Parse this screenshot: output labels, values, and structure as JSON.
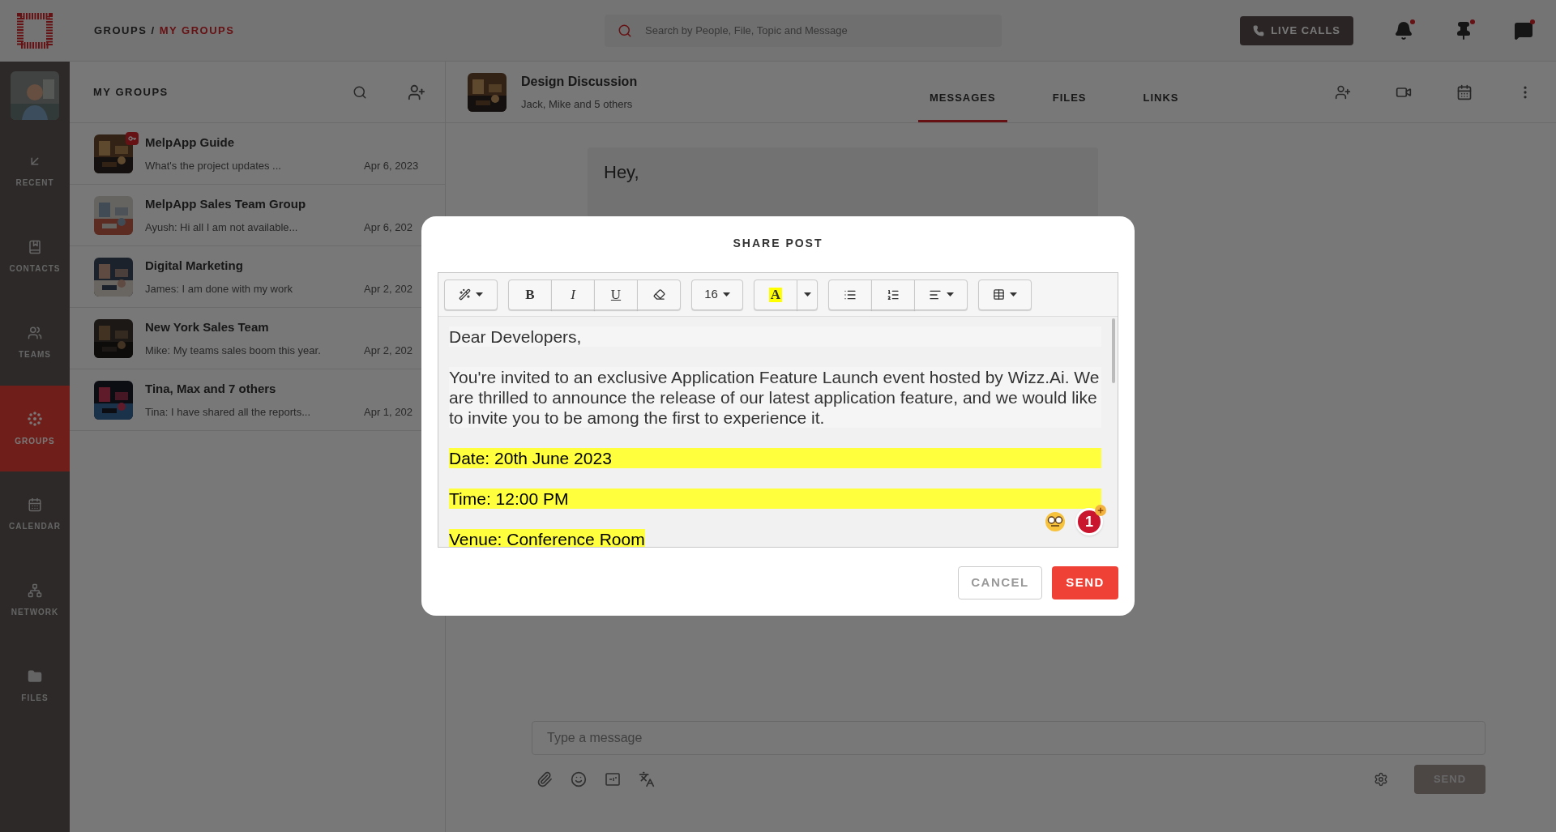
{
  "breadcrumb": {
    "parent": "GROUPS",
    "separator": "/",
    "current": "MY GROUPS"
  },
  "search": {
    "placeholder": "Search by People, File, Topic and Message"
  },
  "live_calls": "LIVE CALLS",
  "top_icons": [
    {
      "kind": "bell",
      "badge": true
    },
    {
      "kind": "pin",
      "badge": true
    },
    {
      "kind": "chat",
      "badge": true
    }
  ],
  "nav": [
    {
      "kind": "recent",
      "label": "RECENT",
      "selected": false
    },
    {
      "kind": "contacts",
      "label": "CONTACTS",
      "selected": false
    },
    {
      "kind": "teams",
      "label": "TEAMS",
      "selected": false
    },
    {
      "kind": "groups",
      "label": "GROUPS",
      "selected": true
    },
    {
      "kind": "calendar",
      "label": "CALENDAR",
      "selected": false
    },
    {
      "kind": "network",
      "label": "NETWORK",
      "selected": false
    },
    {
      "kind": "files",
      "label": "FILES",
      "selected": false
    }
  ],
  "groups_panel": {
    "title": "MY GROUPS",
    "items": [
      {
        "name": "MelpApp Guide",
        "preview": "What's the project updates ...",
        "date": "Apr 6, 2023",
        "locked": true
      },
      {
        "name": "MelpApp Sales Team Group",
        "preview": "Ayush: Hi all I am not available...",
        "date": "Apr 6, 202",
        "locked": false
      },
      {
        "name": "Digital Marketing",
        "preview": "James: I am done with my work",
        "date": "Apr 2, 202",
        "locked": false
      },
      {
        "name": "New York Sales Team",
        "preview": "Mike: My teams sales boom this year.",
        "date": "Apr 2, 202",
        "locked": false
      },
      {
        "name": "Tina, Max and 7 others",
        "preview": "Tina: I have shared all the reports...",
        "date": "Apr 1, 202",
        "locked": false
      }
    ]
  },
  "chat": {
    "title": "Design Discussion",
    "members": "Jack, Mike and 5 others",
    "tabs": [
      {
        "label": "MESSAGES",
        "selected": true
      },
      {
        "label": "FILES",
        "selected": false
      },
      {
        "label": "LINKS",
        "selected": false
      }
    ],
    "actions": [
      {
        "kind": "add_member"
      },
      {
        "kind": "video"
      },
      {
        "kind": "calendar"
      },
      {
        "kind": "more"
      }
    ],
    "messages": [
      "Hey,"
    ],
    "composer": {
      "placeholder": "Type a message",
      "tools": [
        {
          "kind": "attach"
        },
        {
          "kind": "emoji"
        },
        {
          "kind": "gif"
        },
        {
          "kind": "translate"
        }
      ],
      "send": "SEND"
    }
  },
  "modal": {
    "title": "SHARE POST",
    "toolbar": [
      {
        "buttons": [
          {
            "kind": "style"
          }
        ]
      },
      {
        "buttons": [
          {
            "kind": "bold",
            "label": "B"
          },
          {
            "kind": "italic",
            "label": "I"
          },
          {
            "kind": "underline",
            "label": "U"
          },
          {
            "kind": "eraser"
          }
        ]
      },
      {
        "buttons": [
          {
            "kind": "font_size",
            "label": "16"
          }
        ]
      },
      {
        "buttons": [
          {
            "kind": "color",
            "label": "A"
          },
          {
            "kind": "color_menu"
          }
        ]
      },
      {
        "buttons": [
          {
            "kind": "bullets"
          },
          {
            "kind": "numbers"
          },
          {
            "kind": "align"
          }
        ]
      },
      {
        "buttons": [
          {
            "kind": "table"
          }
        ]
      }
    ],
    "paragraphs": [
      {
        "text": "Dear Developers,",
        "highlighted": false,
        "kind": "line"
      },
      {
        "text": "You're invited to an exclusive Application Feature Launch event hosted by Wizz.Ai. We are thrilled to announce the release of our latest application feature, and we would like to invite you to be among the first to experience it.",
        "highlighted": false,
        "kind": "line"
      },
      {
        "text": "Date: 20th June 2023",
        "highlighted": true,
        "kind": "line"
      },
      {
        "text": "Time: 12:00 PM",
        "highlighted": true,
        "kind": "line"
      },
      {
        "text": "Venue: Conference Room",
        "highlighted": true,
        "kind": "span"
      }
    ],
    "grammar_count": "1",
    "cancel": "CANCEL",
    "send": "SEND"
  }
}
